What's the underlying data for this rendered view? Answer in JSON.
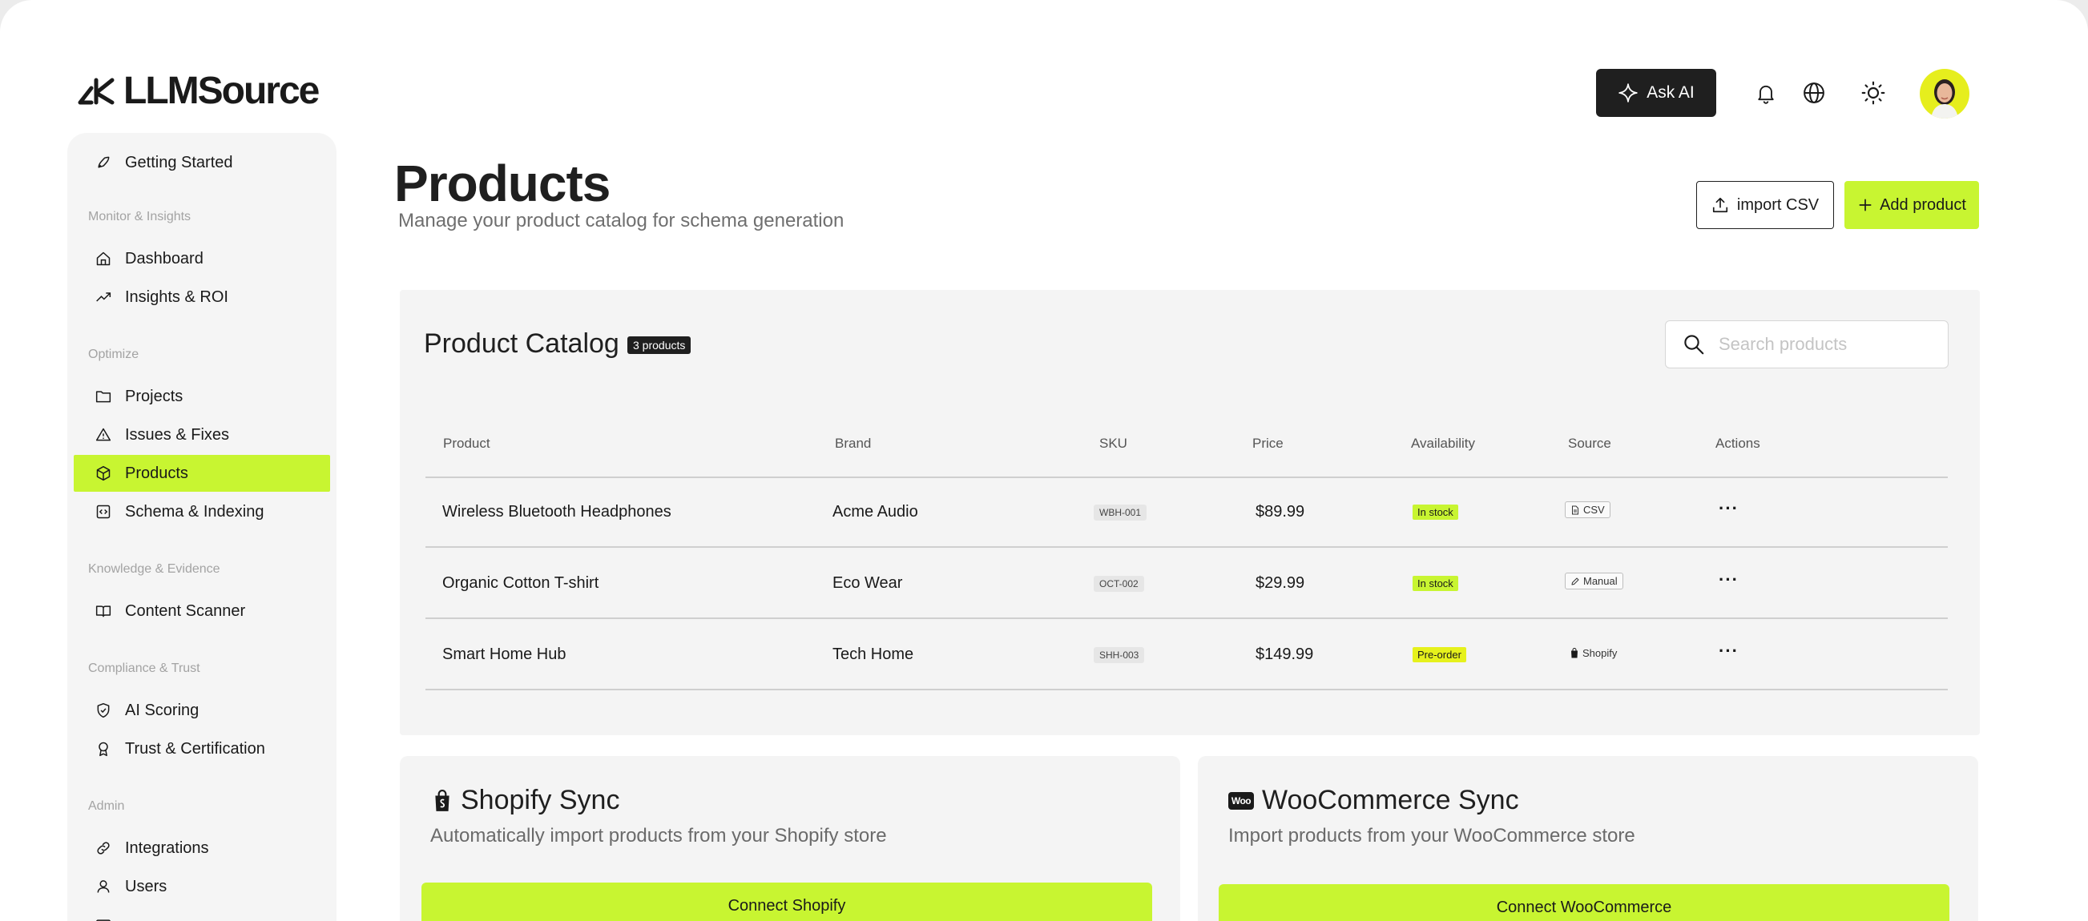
{
  "brand": {
    "logo_text": "LLMSource"
  },
  "header": {
    "ask_ai_label": "Ask AI"
  },
  "sidebar": {
    "getting_started": "Getting Started",
    "sections": {
      "monitor": "Monitor & Insights",
      "optimize": "Optimize",
      "knowledge": "Knowledge & Evidence",
      "compliance": "Compliance & Trust",
      "admin": "Admin"
    },
    "items": {
      "dashboard": "Dashboard",
      "insights": "Insights & ROI",
      "projects": "Projects",
      "issues": "Issues & Fixes",
      "products": "Products",
      "schema": "Schema & Indexing",
      "scanner": "Content Scanner",
      "scoring": "AI Scoring",
      "trust": "Trust & Certification",
      "integrations": "Integrations",
      "users": "Users"
    }
  },
  "page": {
    "title": "Products",
    "subtitle": "Manage your product catalog for schema generation",
    "import_label": "import CSV",
    "add_label": "Add product"
  },
  "catalog": {
    "title": "Product Catalog",
    "count": "3 products",
    "search_placeholder": "Search products",
    "columns": {
      "product": "Product",
      "brand": "Brand",
      "sku": "SKU",
      "price": "Price",
      "availability": "Availability",
      "source": "Source",
      "actions": "Actions"
    },
    "rows": [
      {
        "product": "Wireless Bluetooth Headphones",
        "brand": "Acme Audio",
        "sku": "WBH-001",
        "price": "$89.99",
        "availability": "In stock",
        "source": "CSV",
        "actions": "···"
      },
      {
        "product": "Organic Cotton T-shirt",
        "brand": "Eco Wear",
        "sku": "OCT-002",
        "price": "$29.99",
        "availability": "In stock",
        "source": "Manual",
        "actions": "···"
      },
      {
        "product": "Smart Home Hub",
        "brand": "Tech Home",
        "sku": "SHH-003",
        "price": "$149.99",
        "availability": "Pre-order",
        "source": "Shopify",
        "actions": "···"
      }
    ]
  },
  "shopify": {
    "title": "Shopify Sync",
    "description": "Automatically import products from your Shopify store",
    "button": "Connect Shopify"
  },
  "woocommerce": {
    "title": "WooCommerce Sync",
    "description": "Import products from your WooCommerce store",
    "button": "Connect WooCommerce",
    "icon_text": "Woo"
  },
  "colors": {
    "accent": "#c8f531",
    "dark": "#1f1f1f",
    "panel": "#f4f4f4"
  }
}
